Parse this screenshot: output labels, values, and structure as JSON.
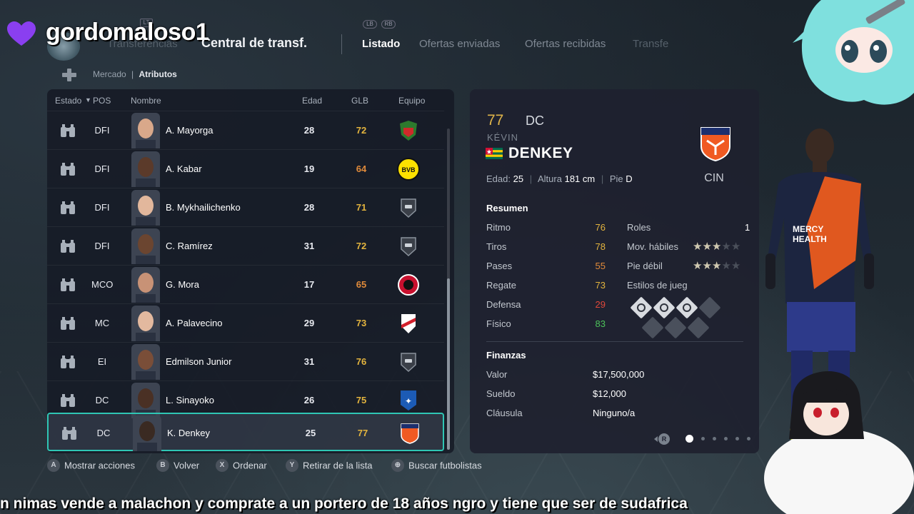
{
  "overlay": {
    "stream_username": "gordomaloso1",
    "chat_message": "n nimas vende a malachon y comprate a un portero de 18 años ngro y tiene que ser de sudafrica"
  },
  "header": {
    "lt_label": "LT",
    "lb_label": "LB",
    "rb_label": "RB",
    "tabs": [
      {
        "label": "Transferencias",
        "state": "dim"
      },
      {
        "label": "Central de transf.",
        "state": "big"
      },
      {
        "label": "Listado",
        "state": "active"
      },
      {
        "label": "Ofertas enviadas",
        "state": "normal"
      },
      {
        "label": "Ofertas recibidas",
        "state": "normal"
      },
      {
        "label": "Transfe",
        "state": "dim"
      }
    ]
  },
  "breadcrumb": {
    "first": "Mercado",
    "separator": "|",
    "second": "Atributos"
  },
  "list": {
    "columns": {
      "estado": "Estado",
      "sort_icon": "▼",
      "pos": "POS",
      "nombre": "Nombre",
      "edad": "Edad",
      "glb": "GLB",
      "equipo": "Equipo"
    },
    "rows": [
      {
        "pos": "DFI",
        "name": "A. Mayorga",
        "age": "28",
        "glb": "72",
        "glb_color": "#e3b43e",
        "crest": "juarez-crest"
      },
      {
        "pos": "DFI",
        "name": "A. Kabar",
        "age": "19",
        "glb": "64",
        "glb_color": "#e08a3a",
        "crest": "bvb-crest"
      },
      {
        "pos": "DFI",
        "name": "B. Mykhailichenko",
        "age": "28",
        "glb": "71",
        "glb_color": "#e3b43e",
        "crest": "generic-crest"
      },
      {
        "pos": "DFI",
        "name": "C. Ramírez",
        "age": "31",
        "glb": "72",
        "glb_color": "#e3b43e",
        "crest": "generic-crest"
      },
      {
        "pos": "MCO",
        "name": "G. Mora",
        "age": "17",
        "glb": "65",
        "glb_color": "#e08a3a",
        "crest": "tijuana-crest"
      },
      {
        "pos": "MC",
        "name": "A. Palavecino",
        "age": "29",
        "glb": "73",
        "glb_color": "#e3b43e",
        "crest": "river-crest"
      },
      {
        "pos": "EI",
        "name": "Edmilson Junior",
        "age": "31",
        "glb": "76",
        "glb_color": "#e3b43e",
        "crest": "generic-crest"
      },
      {
        "pos": "DC",
        "name": "L. Sinayoko",
        "age": "26",
        "glb": "75",
        "glb_color": "#e3b43e",
        "crest": "auxerre-crest"
      },
      {
        "pos": "DC",
        "name": "K. Denkey",
        "age": "25",
        "glb": "77",
        "glb_color": "#e3b43e",
        "crest": "cincinnati-crest",
        "selected": true
      }
    ]
  },
  "player": {
    "ovr": "77",
    "position": "DC",
    "first_name": "KÉVIN",
    "last_name": "DENKEY",
    "flag": "togo-flag",
    "age_label": "Edad:",
    "age": "25",
    "height_label": "Altura",
    "height": "181 cm",
    "foot_label": "Pie",
    "foot": "D",
    "club": "CIN",
    "summary_title": "Resumen",
    "stats": [
      {
        "label": "Ritmo",
        "value": "76",
        "color": "#e3b43e"
      },
      {
        "label": "Tiros",
        "value": "78",
        "color": "#e3b43e"
      },
      {
        "label": "Pases",
        "value": "55",
        "color": "#e08a3a"
      },
      {
        "label": "Regate",
        "value": "73",
        "color": "#e3b43e"
      },
      {
        "label": "Defensa",
        "value": "29",
        "color": "#e0483a"
      },
      {
        "label": "Físico",
        "value": "83",
        "color": "#4cc25a"
      }
    ],
    "roles_label": "Roles",
    "roles_value": "1",
    "skill_moves_label": "Mov. hábiles",
    "skill_moves_stars": 3,
    "weak_foot_label": "Pie débil",
    "weak_foot_stars": 3,
    "playstyles_label": "Estilos de jueg",
    "playstyles_active": 3,
    "playstyles_total": 7,
    "finance_title": "Finanzas",
    "finances": [
      {
        "label": "Valor",
        "value": "$17,500,000"
      },
      {
        "label": "Sueldo",
        "value": "$12,000"
      },
      {
        "label": "Cláusula",
        "value": "Ninguno/a"
      }
    ],
    "pager_button": "R",
    "page_current": 1,
    "page_total": 6
  },
  "hints": [
    {
      "button": "A",
      "label": "Mostrar acciones"
    },
    {
      "button": "B",
      "label": "Volver"
    },
    {
      "button": "X",
      "label": "Ordenar"
    },
    {
      "button": "Y",
      "label": "Retirar de la lista"
    },
    {
      "button": "⊕",
      "label": "Buscar futbolistas"
    }
  ],
  "colors": {
    "accent": "#2fc6b4",
    "gold": "#e3b43e",
    "orange_club": "#f05a22"
  }
}
